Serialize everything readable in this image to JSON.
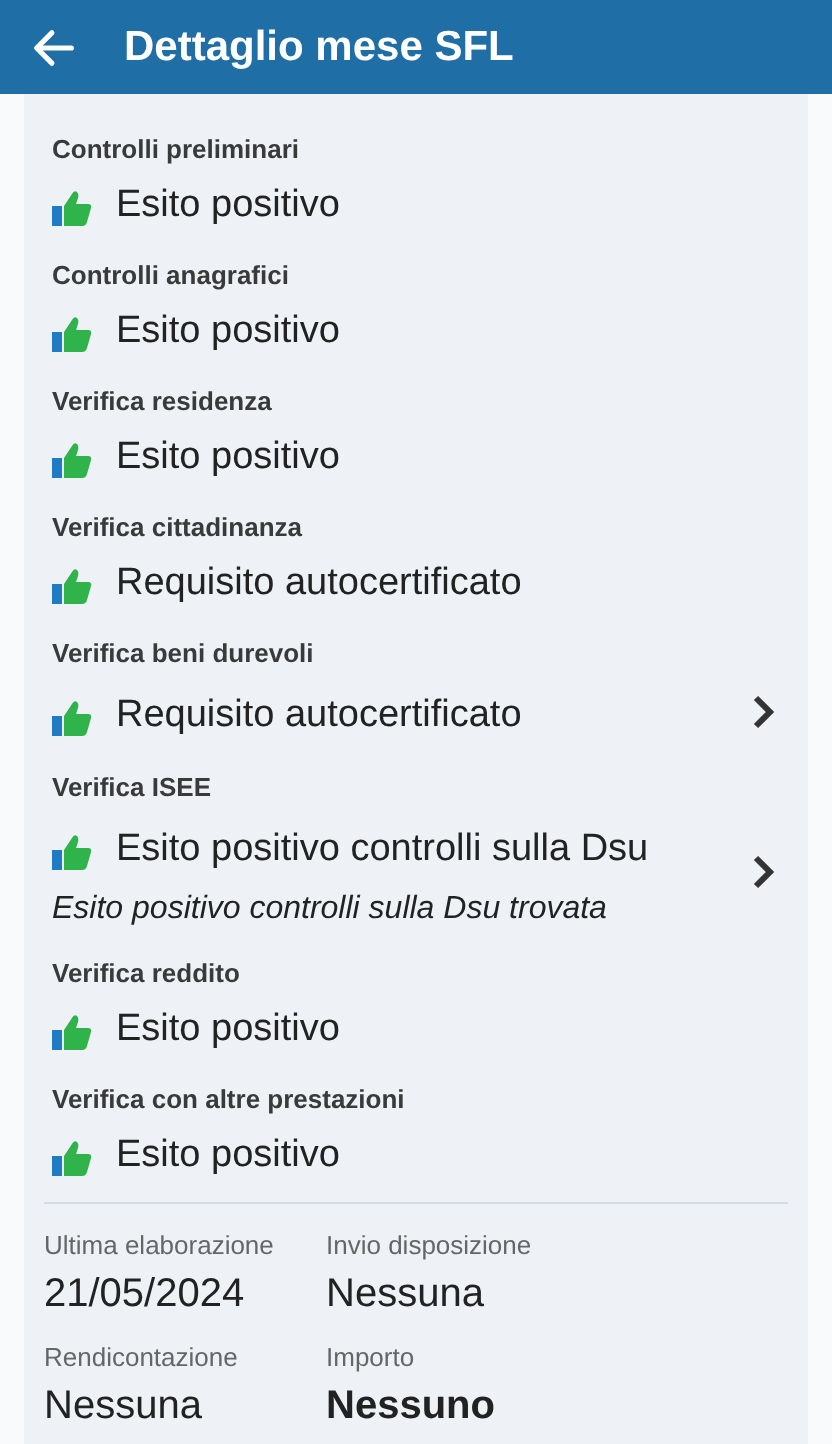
{
  "header": {
    "title": "Dettaglio mese SFL"
  },
  "checks": [
    {
      "label": "Controlli preliminari",
      "value": "Esito positivo",
      "has_detail": false
    },
    {
      "label": "Controlli anagrafici",
      "value": "Esito positivo",
      "has_detail": false
    },
    {
      "label": "Verifica residenza",
      "value": "Esito positivo",
      "has_detail": false
    },
    {
      "label": "Verifica cittadinanza",
      "value": "Requisito autocertificato",
      "has_detail": false
    },
    {
      "label": "Verifica beni durevoli",
      "value": "Requisito autocertificato",
      "has_detail": true
    },
    {
      "label": "Verifica ISEE",
      "value": "Esito positivo controlli sulla Dsu",
      "note": "Esito positivo controlli sulla Dsu trovata",
      "has_detail": true
    },
    {
      "label": "Verifica reddito",
      "value": "Esito positivo",
      "has_detail": false
    },
    {
      "label": "Verifica con altre prestazioni",
      "value": "Esito positivo",
      "has_detail": false
    }
  ],
  "summary": [
    {
      "label": "Ultima elaborazione",
      "value": "21/05/2024",
      "bold": false
    },
    {
      "label": "Invio disposizione",
      "value": "Nessuna",
      "bold": false
    },
    {
      "label": "Rendicontazione",
      "value": "Nessuna",
      "bold": false
    },
    {
      "label": "Importo",
      "value": "Nessuno",
      "bold": true
    }
  ]
}
